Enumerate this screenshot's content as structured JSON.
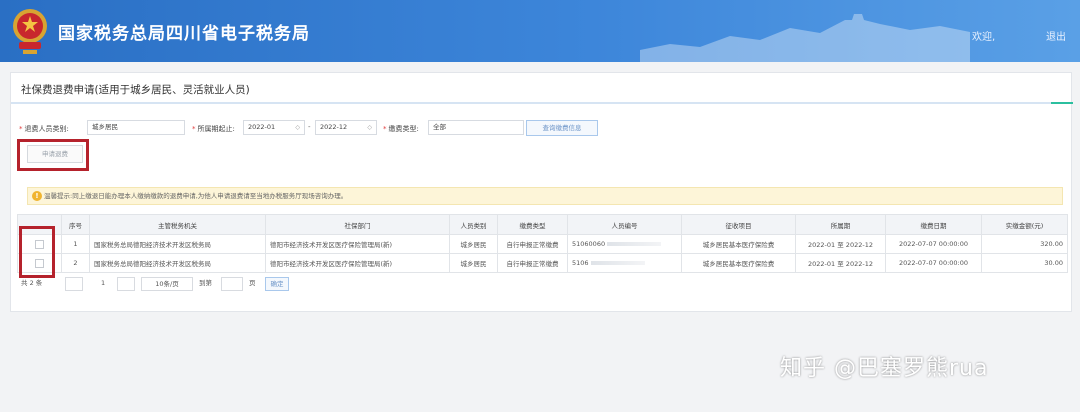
{
  "header": {
    "site_title": "国家税务总局四川省电子税务局",
    "welcome": "欢迎,",
    "logout": "退出"
  },
  "page": {
    "title": "社保费退费申请(适用于城乡居民、灵活就业人员)"
  },
  "filters": {
    "refund_type_label": "退费人员类别:",
    "refund_type_value": "城乡居民",
    "period_label": "所属期起止:",
    "period_start": "2022-01",
    "period_end": "2022-12",
    "period_separator": "-",
    "fee_type_label": "缴费类型:",
    "fee_type_value": "全部",
    "query_button": "查询缴费信息"
  },
  "actions": {
    "apply_button": "申请退费"
  },
  "tip": {
    "text": "温馨提示:同上缴退日能办理本人缴纳缴款的退费申请,为他人申请退费请至当地办税服务厅现场咨询办理。"
  },
  "table": {
    "headers": [
      "",
      "序号",
      "主管税务机关",
      "社保部门",
      "人员类别",
      "缴费类型",
      "人员编号",
      "征收项目",
      "所属期",
      "缴费日期",
      "实缴金额(元)"
    ],
    "rows": [
      {
        "index": "1",
        "tax_office": "国家税务总局德阳经济技术开发区税务局",
        "social_dept": "德阳市经济技术开发区医疗保险管理局(新)",
        "person_type": "城乡居民",
        "fee_type": "自行申报正常缴费",
        "person_no": "51060060",
        "item": "城乡居民基本医疗保险费",
        "period": "2022-01 至 2022-12",
        "pay_date": "2022-07-07 00:00:00",
        "amount": "320.00"
      },
      {
        "index": "2",
        "tax_office": "国家税务总局德阳经济技术开发区税务局",
        "social_dept": "德阳市经济技术开发区医疗保险管理局(新)",
        "person_type": "城乡居民",
        "fee_type": "自行申报正常缴费",
        "person_no": "5106",
        "item": "城乡居民基本医疗保险费",
        "period": "2022-01 至 2022-12",
        "pay_date": "2022-07-07 00:00:00",
        "amount": "30.00"
      }
    ]
  },
  "pager": {
    "total": "共 2 条",
    "current_page": "1",
    "page_size": "10条/页",
    "goto_label": "到第",
    "page_unit": "页",
    "confirm": "确定"
  },
  "watermark": "知乎 @巴塞罗熊rua",
  "colors": {
    "header_blue": "#3d86da",
    "highlight_red": "#b5222c",
    "tip_background": "#fdf5d8"
  }
}
